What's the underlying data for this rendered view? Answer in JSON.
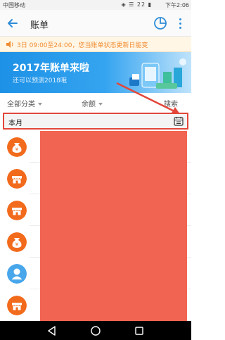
{
  "status_bar": {
    "left": "中国移动",
    "icons": "◈ ☰ 22 ▮",
    "time": "下午2:06"
  },
  "header": {
    "title": "账单"
  },
  "notice": {
    "text": "3日 09:00至24:00，您当账单状态更新日能变"
  },
  "banner": {
    "title": "2017年账单来啦",
    "subtitle": "还可以预测2018哦"
  },
  "filters": {
    "category": "全部分类",
    "amount": "余额",
    "search": "搜索"
  },
  "month": {
    "label": "本月"
  },
  "list": {
    "items": [
      {
        "icon": "money-bag-icon",
        "symbol": "¥"
      },
      {
        "icon": "shop-icon"
      },
      {
        "icon": "shop-icon"
      },
      {
        "icon": "money-bag-icon",
        "symbol": "¥"
      },
      {
        "icon": "person-icon"
      },
      {
        "icon": "shop-icon"
      }
    ]
  },
  "colors": {
    "accent": "#2f8dd8",
    "orange_icon": "#f26a1b",
    "blue_icon": "#48a6ea",
    "redaction": "#f26452",
    "annotation": "#e2473a"
  }
}
